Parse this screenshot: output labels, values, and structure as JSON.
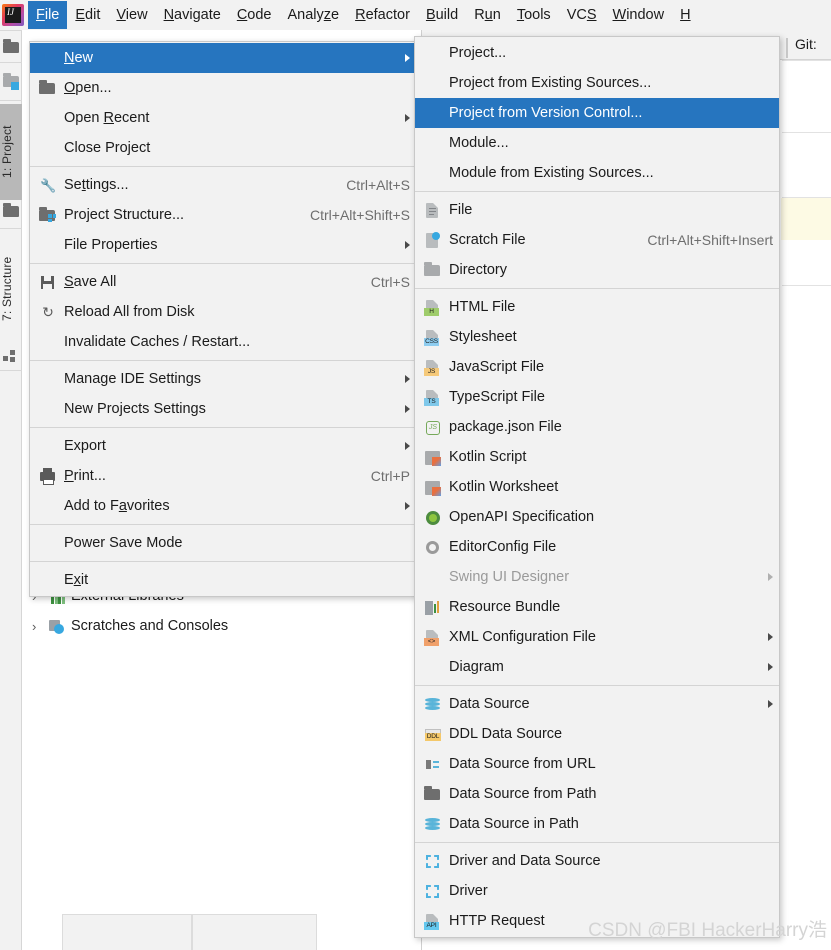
{
  "app": {
    "logo_icon": "intellij-idea-logo",
    "watermark": "CSDN @FBI HackerHarry浩"
  },
  "menubar": {
    "items": [
      {
        "label": "File",
        "mnemonic": "F",
        "selected": true
      },
      {
        "label": "Edit",
        "mnemonic": "E",
        "selected": false
      },
      {
        "label": "View",
        "mnemonic": "V",
        "selected": false
      },
      {
        "label": "Navigate",
        "mnemonic": "N",
        "selected": false
      },
      {
        "label": "Code",
        "mnemonic": "C",
        "selected": false
      },
      {
        "label": "Analyze",
        "mnemonic": "z",
        "selected": false
      },
      {
        "label": "Refactor",
        "mnemonic": "R",
        "selected": false
      },
      {
        "label": "Build",
        "mnemonic": "B",
        "selected": false
      },
      {
        "label": "Run",
        "mnemonic": "u",
        "selected": false
      },
      {
        "label": "Tools",
        "mnemonic": "T",
        "selected": false
      },
      {
        "label": "VCS",
        "mnemonic": "S",
        "selected": false
      },
      {
        "label": "Window",
        "mnemonic": "W",
        "selected": false
      },
      {
        "label": "H",
        "mnemonic": "H",
        "selected": false
      }
    ]
  },
  "left_rail": {
    "open_icon": "open-folder-icon",
    "project_folder_icon": "project-folder-icon",
    "items": [
      {
        "label": "1: Project",
        "icon": "project-icon",
        "active": true
      },
      {
        "label": "7: Structure",
        "icon": "structure-icon",
        "active": false
      }
    ]
  },
  "editor": {
    "tab_label": "Git:"
  },
  "project_tree": {
    "rows": [
      {
        "label": "External Libraries",
        "icon": "libraries-icon",
        "arrow": "›"
      },
      {
        "label": "Scratches and Consoles",
        "icon": "scratches-icon",
        "arrow": "›"
      }
    ]
  },
  "file_menu": {
    "items": [
      {
        "label": "New",
        "mnemonic": "N",
        "icon": null,
        "accel": "",
        "submenu": true,
        "highlight": true
      },
      {
        "label": "Open...",
        "mnemonic": "O",
        "icon": "open-folder-icon",
        "accel": "",
        "submenu": false
      },
      {
        "label": "Open Recent",
        "mnemonic": "R",
        "icon": null,
        "accel": "",
        "submenu": true
      },
      {
        "label": "Close Project",
        "icon": null,
        "accel": "",
        "submenu": false
      },
      {
        "separator": true
      },
      {
        "label": "Settings...",
        "mnemonic": "t",
        "icon": "wrench-icon",
        "accel": "Ctrl+Alt+S",
        "submenu": false
      },
      {
        "label": "Project Structure...",
        "icon": "project-structure-icon",
        "accel": "Ctrl+Alt+Shift+S",
        "submenu": false
      },
      {
        "label": "File Properties",
        "icon": null,
        "accel": "",
        "submenu": true
      },
      {
        "separator": true
      },
      {
        "label": "Save All",
        "mnemonic": "S",
        "icon": "save-icon",
        "accel": "Ctrl+S",
        "submenu": false
      },
      {
        "label": "Reload All from Disk",
        "icon": "reload-icon",
        "accel": "",
        "submenu": false
      },
      {
        "label": "Invalidate Caches / Restart...",
        "icon": null,
        "accel": "",
        "submenu": false
      },
      {
        "separator": true
      },
      {
        "label": "Manage IDE Settings",
        "icon": null,
        "accel": "",
        "submenu": true
      },
      {
        "label": "New Projects Settings",
        "icon": null,
        "accel": "",
        "submenu": true
      },
      {
        "separator": true
      },
      {
        "label": "Export",
        "icon": null,
        "accel": "",
        "submenu": true
      },
      {
        "label": "Print...",
        "mnemonic": "P",
        "icon": "printer-icon",
        "accel": "Ctrl+P",
        "submenu": false
      },
      {
        "label": "Add to Favorites",
        "mnemonic": "a",
        "icon": null,
        "accel": "",
        "submenu": true
      },
      {
        "separator": true
      },
      {
        "label": "Power Save Mode",
        "icon": null,
        "accel": "",
        "submenu": false
      },
      {
        "separator": true
      },
      {
        "label": "Exit",
        "mnemonic": "x",
        "icon": null,
        "accel": "",
        "submenu": false
      }
    ]
  },
  "new_submenu": {
    "items": [
      {
        "label": "Project...",
        "icon": null,
        "accel": "",
        "submenu": false
      },
      {
        "label": "Project from Existing Sources...",
        "icon": null,
        "accel": "",
        "submenu": false
      },
      {
        "label": "Project from Version Control...",
        "icon": null,
        "accel": "",
        "submenu": false,
        "highlight": true
      },
      {
        "label": "Module...",
        "icon": null,
        "accel": "",
        "submenu": false
      },
      {
        "label": "Module from Existing Sources...",
        "icon": null,
        "accel": "",
        "submenu": false
      },
      {
        "separator": true
      },
      {
        "label": "File",
        "icon": "file-icon",
        "accel": "",
        "submenu": false
      },
      {
        "label": "Scratch File",
        "icon": "scratch-file-icon",
        "accel": "Ctrl+Alt+Shift+Insert",
        "submenu": false
      },
      {
        "label": "Directory",
        "icon": "directory-icon",
        "accel": "",
        "submenu": false
      },
      {
        "separator": true
      },
      {
        "label": "HTML File",
        "icon": "html-file-icon",
        "accel": "",
        "submenu": false
      },
      {
        "label": "Stylesheet",
        "icon": "css-file-icon",
        "accel": "",
        "submenu": false
      },
      {
        "label": "JavaScript File",
        "icon": "js-file-icon",
        "accel": "",
        "submenu": false
      },
      {
        "label": "TypeScript File",
        "icon": "ts-file-icon",
        "accel": "",
        "submenu": false
      },
      {
        "label": "package.json File",
        "icon": "nodejs-icon",
        "accel": "",
        "submenu": false
      },
      {
        "label": "Kotlin Script",
        "icon": "kotlin-icon",
        "accel": "",
        "submenu": false
      },
      {
        "label": "Kotlin Worksheet",
        "icon": "kotlin-icon",
        "accel": "",
        "submenu": false
      },
      {
        "label": "OpenAPI Specification",
        "icon": "openapi-icon",
        "accel": "",
        "submenu": false
      },
      {
        "label": "EditorConfig File",
        "icon": "gear-icon",
        "accel": "",
        "submenu": false
      },
      {
        "label": "Swing UI Designer",
        "icon": null,
        "accel": "",
        "submenu": true,
        "disabled": true
      },
      {
        "label": "Resource Bundle",
        "icon": "resource-bundle-icon",
        "accel": "",
        "submenu": false
      },
      {
        "label": "XML Configuration File",
        "icon": "xml-file-icon",
        "accel": "",
        "submenu": true
      },
      {
        "label": "Diagram",
        "icon": null,
        "accel": "",
        "submenu": true
      },
      {
        "separator": true
      },
      {
        "label": "Data Source",
        "icon": "database-icon",
        "accel": "",
        "submenu": true
      },
      {
        "label": "DDL Data Source",
        "icon": "ddl-icon",
        "accel": "",
        "submenu": false
      },
      {
        "label": "Data Source from URL",
        "icon": "plug-icon",
        "accel": "",
        "submenu": false
      },
      {
        "label": "Data Source from Path",
        "icon": "open-folder-icon",
        "accel": "",
        "submenu": false
      },
      {
        "label": "Data Source in Path",
        "icon": "database-icon",
        "accel": "",
        "submenu": false
      },
      {
        "separator": true
      },
      {
        "label": "Driver and Data Source",
        "icon": "driver-icon",
        "accel": "",
        "submenu": false
      },
      {
        "label": "Driver",
        "icon": "driver-icon",
        "accel": "",
        "submenu": false
      },
      {
        "label": "HTTP Request",
        "icon": "http-request-icon",
        "accel": "",
        "submenu": false
      }
    ]
  },
  "colors": {
    "highlight": "#2675bf",
    "menu_bg": "#f2f2f2",
    "text": "#1b1b1b",
    "accel_text": "#6e6e6e",
    "disabled_text": "#9a9a9a"
  }
}
